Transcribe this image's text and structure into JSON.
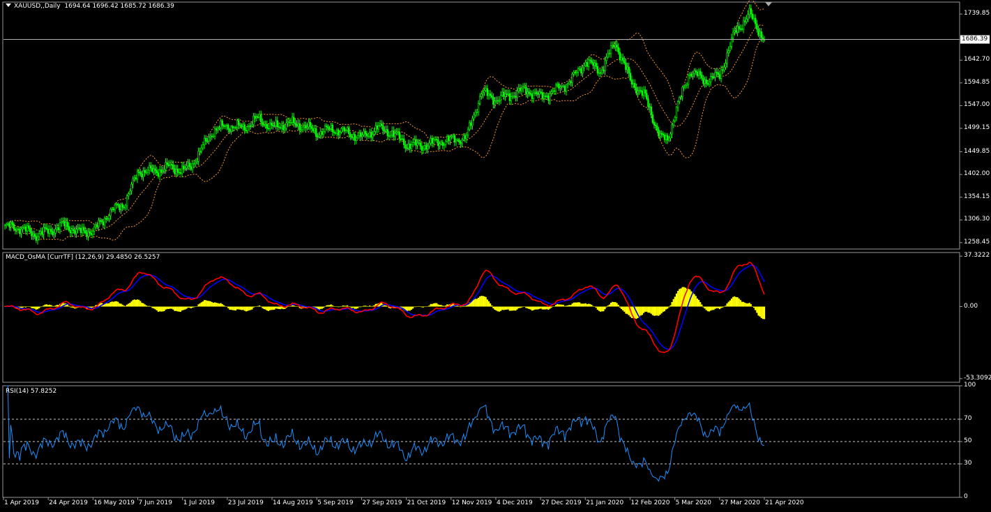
{
  "symbol_header": {
    "symbol": "XAUUSD,,Daily",
    "ohlc": "1694.64 1696.42 1685.72 1686.39"
  },
  "macd_header": "MACD_OsMA [CurrTF] (12,26,9) 29.4850 26.5257",
  "rsi_header": "RSI(14) 57.8252",
  "current_price": "1686.39",
  "colors": {
    "bull": "#00ff00",
    "bands": "#ff9a2e",
    "osma": "#ffff00",
    "macd": "#ff0000",
    "signal": "#0000ff",
    "rsi": "#1e90ff",
    "frame": "#9a9a9a"
  },
  "chart_data": [
    {
      "type": "candlestick",
      "title": "XAUUSD,,Daily",
      "ylim": [
        1245,
        1765
      ],
      "y_ticks": [
        "1739.85",
        "1686.39",
        "1642.70",
        "1594.85",
        "1547.00",
        "1499.15",
        "1449.85",
        "1402.00",
        "1354.15",
        "1306.30",
        "1258.45"
      ],
      "x_ticks": [
        "1 Apr 2019",
        "24 Apr 2019",
        "16 May 2019",
        "7 Jun 2019",
        "1 Jul 2019",
        "23 Jul 2019",
        "14 Aug 2019",
        "5 Sep 2019",
        "27 Sep 2019",
        "21 Oct 2019",
        "12 Nov 2019",
        "4 Dec 2019",
        "27 Dec 2019",
        "21 Jan 2020",
        "12 Feb 2020",
        "5 Mar 2020",
        "27 Mar 2020",
        "21 Apr 2020"
      ],
      "close_points": [
        [
          0,
          1292
        ],
        [
          10,
          1290
        ],
        [
          20,
          1275
        ],
        [
          30,
          1283
        ],
        [
          40,
          1296
        ],
        [
          50,
          1280
        ],
        [
          60,
          1285
        ],
        [
          66,
          1305
        ],
        [
          70,
          1322
        ],
        [
          80,
          1340
        ],
        [
          90,
          1410
        ],
        [
          100,
          1408
        ],
        [
          110,
          1418
        ],
        [
          120,
          1410
        ],
        [
          125,
          1420
        ],
        [
          140,
          1495
        ],
        [
          150,
          1505
        ],
        [
          160,
          1500
        ],
        [
          170,
          1520
        ],
        [
          180,
          1500
        ],
        [
          190,
          1510
        ],
        [
          200,
          1505
        ],
        [
          210,
          1490
        ],
        [
          220,
          1498
        ],
        [
          230,
          1490
        ],
        [
          240,
          1480
        ],
        [
          250,
          1500
        ],
        [
          260,
          1490
        ],
        [
          270,
          1465
        ],
        [
          280,
          1462
        ],
        [
          290,
          1470
        ],
        [
          300,
          1475
        ],
        [
          310,
          1480
        ],
        [
          320,
          1575
        ],
        [
          330,
          1560
        ],
        [
          340,
          1570
        ],
        [
          350,
          1580
        ],
        [
          360,
          1565
        ],
        [
          370,
          1580
        ],
        [
          380,
          1600
        ],
        [
          390,
          1640
        ],
        [
          400,
          1620
        ],
        [
          410,
          1680
        ],
        [
          420,
          1600
        ],
        [
          430,
          1565
        ],
        [
          440,
          1480
        ],
        [
          445,
          1475
        ],
        [
          450,
          1530
        ],
        [
          460,
          1620
        ],
        [
          470,
          1600
        ],
        [
          480,
          1610
        ],
        [
          490,
          1700
        ],
        [
          500,
          1740
        ],
        [
          510,
          1686
        ]
      ],
      "bollinger": {
        "period": 20,
        "deviation": 2
      }
    },
    {
      "type": "histogram+lines",
      "title": "MACD_OsMA [CurrTF] (12,26,9)",
      "ylim": [
        -56,
        40
      ],
      "y_ticks": [
        "37.3222",
        "0.00",
        "-53.3092"
      ],
      "macd_last": 29.485,
      "signal_last": 26.5257
    },
    {
      "type": "line",
      "title": "RSI(14)",
      "ylim": [
        0,
        100
      ],
      "y_ticks": [
        "100",
        "70",
        "50",
        "30",
        "0"
      ],
      "levels": [
        70,
        50,
        30
      ],
      "last": 57.8252
    }
  ]
}
